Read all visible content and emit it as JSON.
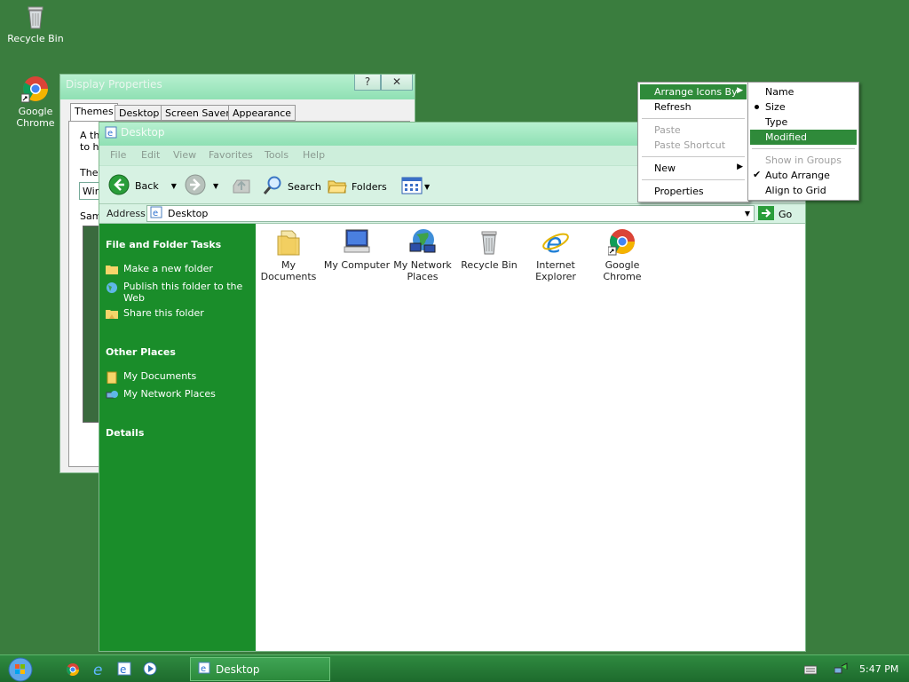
{
  "desktop_icons": [
    {
      "label": "Recycle Bin",
      "icon": "recycle-bin-icon"
    },
    {
      "label": "Google Chrome",
      "icon": "chrome-icon"
    }
  ],
  "display_properties": {
    "title": "Display Properties",
    "help_btn": "?",
    "close_btn": "✕",
    "tabs": [
      "Themes",
      "Desktop",
      "Screen Saver",
      "Appearance"
    ],
    "partial": [
      "A th",
      "to h",
      "The",
      "Win",
      "Sam"
    ]
  },
  "explorer": {
    "title": "Desktop",
    "menu": [
      "File",
      "Edit",
      "View",
      "Favorites",
      "Tools",
      "Help"
    ],
    "toolbar": {
      "back": "Back",
      "search": "Search",
      "folders": "Folders"
    },
    "address_label": "Address",
    "address_value": "Desktop",
    "go_label": "Go",
    "tasks_header": "File and Folder Tasks",
    "tasks": [
      "Make a new folder",
      "Publish this folder to the Web",
      "Share this folder"
    ],
    "other_header": "Other Places",
    "other": [
      "My Documents",
      "My Network Places"
    ],
    "details_header": "Details",
    "items": [
      {
        "label": "My Documents",
        "icon": "my-documents-icon"
      },
      {
        "label": "My Computer",
        "icon": "my-computer-icon"
      },
      {
        "label": "My Network Places",
        "icon": "network-places-icon"
      },
      {
        "label": "Recycle Bin",
        "icon": "recycle-bin-icon"
      },
      {
        "label": "Internet Explorer",
        "icon": "internet-explorer-icon"
      },
      {
        "label": "Google Chrome",
        "icon": "chrome-icon"
      }
    ]
  },
  "context_menu": {
    "items": [
      "Arrange Icons By",
      "Refresh",
      "Paste",
      "Paste Shortcut",
      "New",
      "Properties"
    ]
  },
  "submenu": {
    "items": [
      "Name",
      "Size",
      "Type",
      "Modified",
      "Show in Groups",
      "Auto Arrange",
      "Align to Grid"
    ]
  },
  "taskbar": {
    "task": "Desktop",
    "clock": "5:47 PM"
  },
  "colors": {
    "desktop": "#3a7d3e",
    "sidebar": "#1a8d2a",
    "highlight": "#2f8a3a"
  }
}
